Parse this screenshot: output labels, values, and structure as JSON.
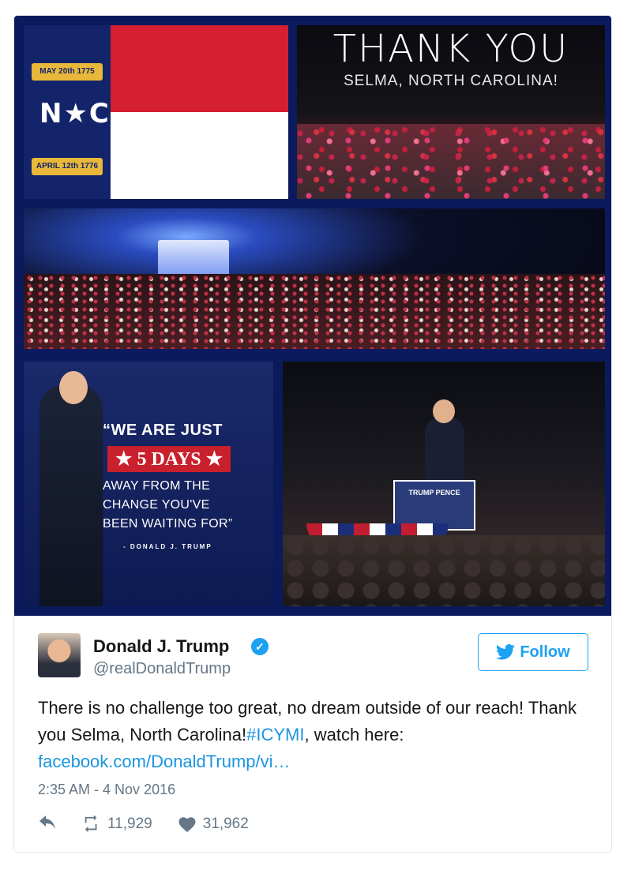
{
  "media": {
    "flag": {
      "top_scroll": "MAY 20th 1775",
      "letters": "N★C",
      "bottom_scroll": "APRIL 12th 1776"
    },
    "thank_you": {
      "title": "THANK YOU",
      "subtitle": "SELMA, NORTH CAROLINA!"
    },
    "quote": {
      "line1": "“WE ARE JUST",
      "banner": "★ 5 DAYS ★",
      "line2": "AWAY FROM THE",
      "line3": "CHANGE YOU'VE",
      "line4": "BEEN WAITING FOR”",
      "attribution": "- DONALD J. TRUMP"
    },
    "podium_sign": "TRUMP PENCE"
  },
  "tweet": {
    "name": "Donald J. Trump",
    "verified_icon": "verified-badge-icon",
    "handle": "@realDonaldTrump",
    "follow_label": "Follow",
    "text_main": "There is no challenge too great, no dream outside of our reach! Thank you Selma, North Carolina!",
    "hashtag": "#ICYMI",
    "text_after": ", watch here: ",
    "link": "facebook.com/DonaldTrump/vi…",
    "timestamp": "2:35 AM - 4 Nov 2016",
    "retweets": "11,929",
    "likes": "31,962"
  },
  "colors": {
    "accent": "#1da1f2",
    "link": "#1b95e0",
    "secondary_text": "#657786",
    "flag_blue": "#13246b",
    "flag_red": "#d51f31"
  }
}
